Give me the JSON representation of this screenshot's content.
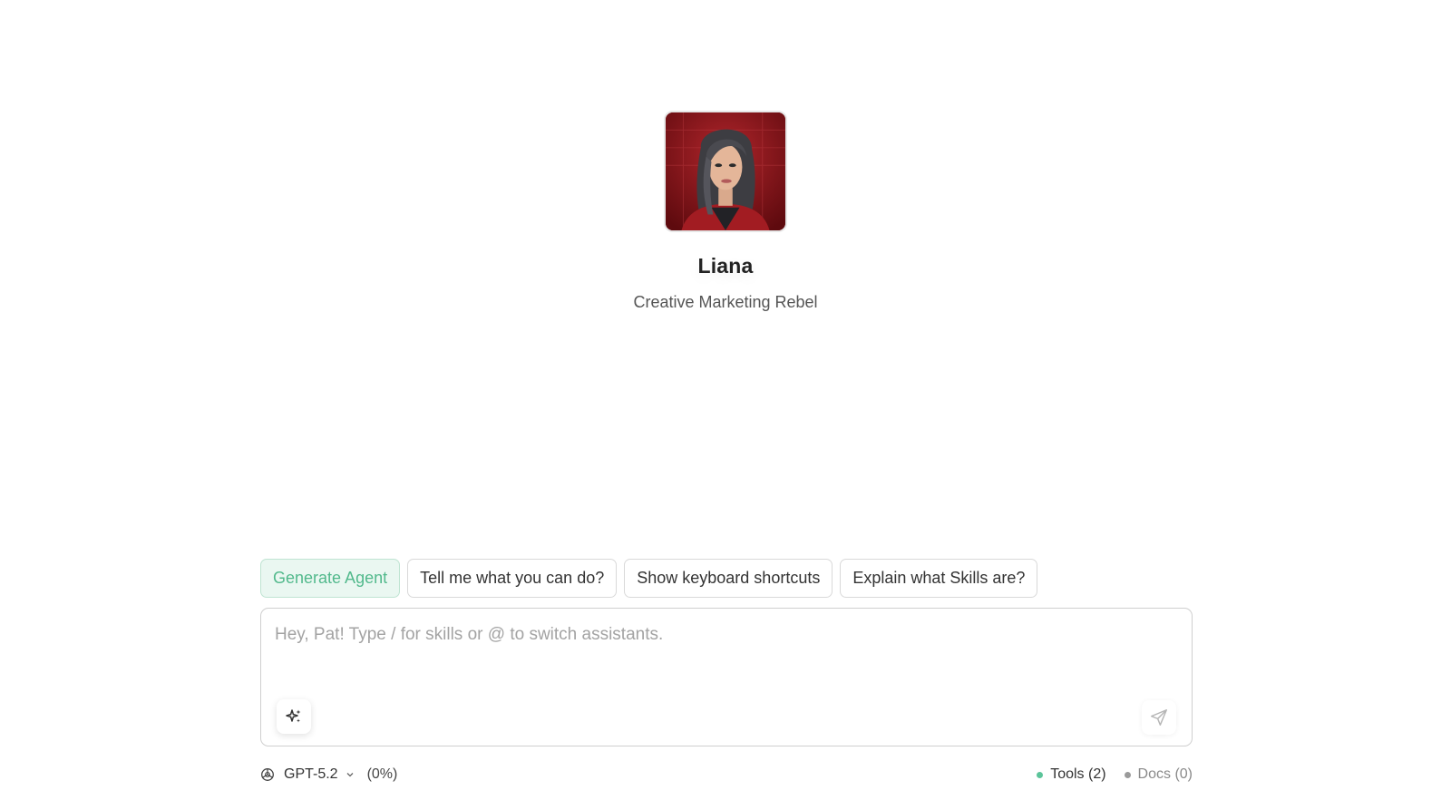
{
  "agent": {
    "name": "Liana",
    "role": "Creative Marketing Rebel",
    "avatar_icon": "agent-portrait"
  },
  "suggestions": [
    {
      "label": "Generate Agent",
      "style": "primary"
    },
    {
      "label": "Tell me what you can do?"
    },
    {
      "label": "Show keyboard shortcuts"
    },
    {
      "label": "Explain what Skills are?"
    }
  ],
  "composer": {
    "placeholder": "Hey, Pat! Type / for skills or @ to switch assistants.",
    "value": "",
    "enhance_icon": "sparkles-icon",
    "send_icon": "send-icon"
  },
  "footer": {
    "model": "GPT-5.2",
    "model_icon": "openai-icon",
    "usage": "(0%)",
    "tools_label": "Tools (2)",
    "docs_label": "Docs (0)",
    "tools_status_color": "#5cc49a",
    "docs_status_color": "#9a9a9a"
  },
  "colors": {
    "accent_green": "#52b98c",
    "accent_green_bg": "#eaf7f1"
  }
}
